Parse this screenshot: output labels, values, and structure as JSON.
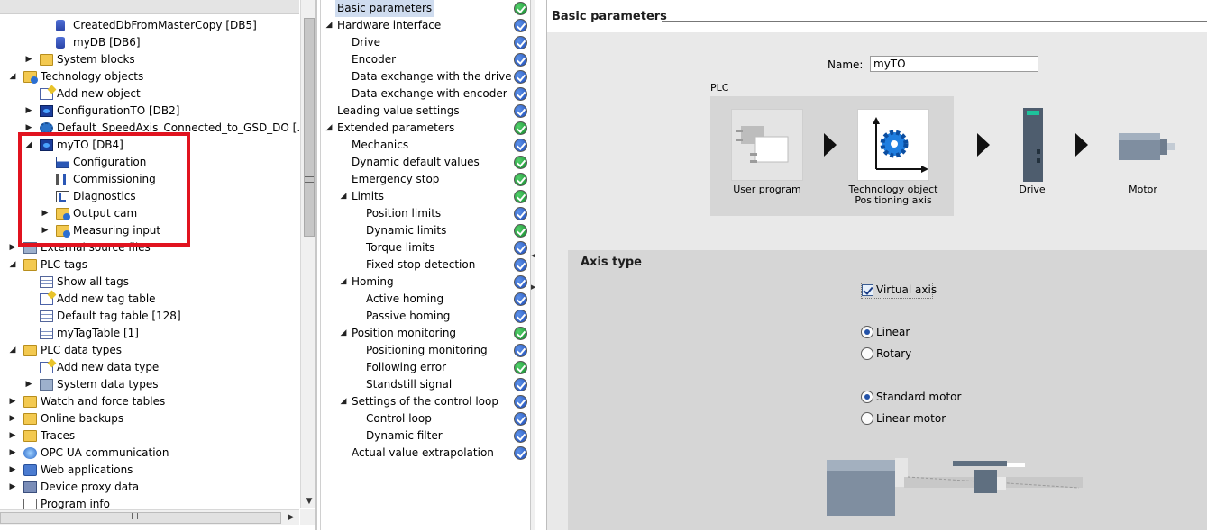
{
  "tree": {
    "items": [
      {
        "label": "CreatedDbFromMasterCopy [DB5]",
        "icon": "db-icon",
        "exp": ""
      },
      {
        "label": "myDB [DB6]",
        "icon": "db-icon",
        "exp": ""
      },
      {
        "label": "System blocks",
        "icon": "folder-icon",
        "exp": "▶"
      },
      {
        "label": "Technology objects",
        "icon": "technology-folder-icon",
        "exp": "◢"
      },
      {
        "label": "Add new object",
        "icon": "add-object-icon",
        "exp": ""
      },
      {
        "label": "ConfigurationTO [DB2]",
        "icon": "technology-object-icon",
        "exp": "▶"
      },
      {
        "label": "Default_SpeedAxis_Connected_to_GSD_DO [...",
        "icon": "speed-axis-icon",
        "exp": "▶"
      },
      {
        "label": "myTO [DB4]",
        "icon": "technology-object-icon",
        "exp": "◢"
      },
      {
        "label": "Configuration",
        "icon": "configuration-icon",
        "exp": ""
      },
      {
        "label": "Commissioning",
        "icon": "commissioning-icon",
        "exp": ""
      },
      {
        "label": "Diagnostics",
        "icon": "diagnostics-icon",
        "exp": ""
      },
      {
        "label": "Output cam",
        "icon": "output-cam-folder-icon",
        "exp": "▶"
      },
      {
        "label": "Measuring input",
        "icon": "measuring-input-folder-icon",
        "exp": "▶"
      },
      {
        "label": "External source files",
        "icon": "source-files-icon",
        "exp": "▶"
      },
      {
        "label": "PLC tags",
        "icon": "folder-icon",
        "exp": "◢"
      },
      {
        "label": "Show all tags",
        "icon": "tags-icon",
        "exp": ""
      },
      {
        "label": "Add new tag table",
        "icon": "add-tag-table-icon",
        "exp": ""
      },
      {
        "label": "Default tag table [128]",
        "icon": "tag-table-icon",
        "exp": ""
      },
      {
        "label": "myTagTable [1]",
        "icon": "tag-table-icon",
        "exp": ""
      },
      {
        "label": "PLC data types",
        "icon": "folder-icon",
        "exp": "◢"
      },
      {
        "label": "Add new data type",
        "icon": "add-data-type-icon",
        "exp": ""
      },
      {
        "label": "System data types",
        "icon": "system-data-types-icon",
        "exp": "▶"
      },
      {
        "label": "Watch and force tables",
        "icon": "folder-icon",
        "exp": "▶"
      },
      {
        "label": "Online backups",
        "icon": "folder-icon",
        "exp": "▶"
      },
      {
        "label": "Traces",
        "icon": "traces-folder-icon",
        "exp": "▶"
      },
      {
        "label": "OPC UA communication",
        "icon": "opc-ua-icon",
        "exp": "▶"
      },
      {
        "label": "Web applications",
        "icon": "web-applications-icon",
        "exp": "▶"
      },
      {
        "label": "Device proxy data",
        "icon": "device-proxy-icon",
        "exp": "▶"
      },
      {
        "label": "Program info",
        "icon": "program-info-icon",
        "exp": ""
      }
    ]
  },
  "nav": {
    "items": [
      {
        "label": "Basic parameters",
        "exp": "",
        "status": "green",
        "active": true
      },
      {
        "label": "Hardware interface",
        "exp": "◢",
        "status": "blue"
      },
      {
        "label": "Drive",
        "exp": "",
        "status": "blue"
      },
      {
        "label": "Encoder",
        "exp": "",
        "status": "blue"
      },
      {
        "label": "Data exchange with the drive",
        "exp": "",
        "status": "blue"
      },
      {
        "label": "Data exchange with encoder",
        "exp": "",
        "status": "blue"
      },
      {
        "label": "Leading value settings",
        "exp": "",
        "status": "blue"
      },
      {
        "label": "Extended parameters",
        "exp": "◢",
        "status": "green"
      },
      {
        "label": "Mechanics",
        "exp": "",
        "status": "blue"
      },
      {
        "label": "Dynamic default values",
        "exp": "",
        "status": "green"
      },
      {
        "label": "Emergency stop",
        "exp": "",
        "status": "green"
      },
      {
        "label": "Limits",
        "exp": "◢",
        "status": "green"
      },
      {
        "label": "Position limits",
        "exp": "",
        "status": "blue"
      },
      {
        "label": "Dynamic limits",
        "exp": "",
        "status": "green"
      },
      {
        "label": "Torque limits",
        "exp": "",
        "status": "blue"
      },
      {
        "label": "Fixed stop detection",
        "exp": "",
        "status": "blue"
      },
      {
        "label": "Homing",
        "exp": "◢",
        "status": "blue"
      },
      {
        "label": "Active homing",
        "exp": "",
        "status": "blue"
      },
      {
        "label": "Passive homing",
        "exp": "",
        "status": "blue"
      },
      {
        "label": "Position monitoring",
        "exp": "◢",
        "status": "green"
      },
      {
        "label": "Positioning monitoring",
        "exp": "",
        "status": "blue"
      },
      {
        "label": "Following error",
        "exp": "",
        "status": "green"
      },
      {
        "label": "Standstill signal",
        "exp": "",
        "status": "blue"
      },
      {
        "label": "Settings of the control loop",
        "exp": "◢",
        "status": "blue"
      },
      {
        "label": "Control loop",
        "exp": "",
        "status": "blue"
      },
      {
        "label": "Dynamic filter",
        "exp": "",
        "status": "blue"
      },
      {
        "label": "Actual value extrapolation",
        "exp": "",
        "status": "blue"
      }
    ]
  },
  "main": {
    "section_title": "Basic parameters",
    "name_label": "Name:",
    "name_value": "myTO",
    "plc_label": "PLC",
    "user_program_label": "User program",
    "technology_object_label_1": "Technology object",
    "technology_object_label_2": "Positioning axis",
    "drive_label": "Drive",
    "motor_label": "Motor",
    "axis_type_title": "Axis type",
    "virtual_axis_label": "Virtual axis",
    "virtual_axis_checked": true,
    "linear_label": "Linear",
    "rotary_label": "Rotary",
    "axis_mode_selected": "Linear",
    "standard_motor_label": "Standard motor",
    "linear_motor_label": "Linear motor",
    "motor_type_selected": "Standard motor"
  },
  "colors": {
    "highlight_box": "#e1131f",
    "status_blue": "#1d4bb4",
    "status_green": "#15862e",
    "panel_gray": "#d6d6d6"
  }
}
